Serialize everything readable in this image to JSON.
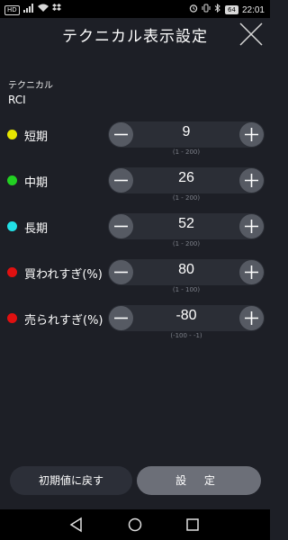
{
  "status_bar": {
    "left_icons": [
      "hd-icon",
      "signal-icon",
      "wifi-icon",
      "dropbox-icon"
    ],
    "right_icons": [
      "alarm-icon",
      "vibrate-icon",
      "bluetooth-icon"
    ],
    "battery": "64",
    "time": "22:01"
  },
  "header": {
    "title": "テクニカル表示設定"
  },
  "technical": {
    "label": "テクニカル",
    "value": "RCI"
  },
  "rows": [
    {
      "label": "短期",
      "value": "9",
      "range": "(1 - 200)",
      "color": "#e6e600"
    },
    {
      "label": "中期",
      "value": "26",
      "range": "(1 - 200)",
      "color": "#22d022"
    },
    {
      "label": "長期",
      "value": "52",
      "range": "(1 - 200)",
      "color": "#22e0e6"
    },
    {
      "label": "買われすぎ(%)",
      "value": "80",
      "range": "(1 - 100)",
      "color": "#e01010"
    },
    {
      "label": "売られすぎ(%)",
      "value": "-80",
      "range": "(-100 - -1)",
      "color": "#e01010"
    }
  ],
  "buttons": {
    "reset": "初期値に戻す",
    "apply": "設 定"
  }
}
